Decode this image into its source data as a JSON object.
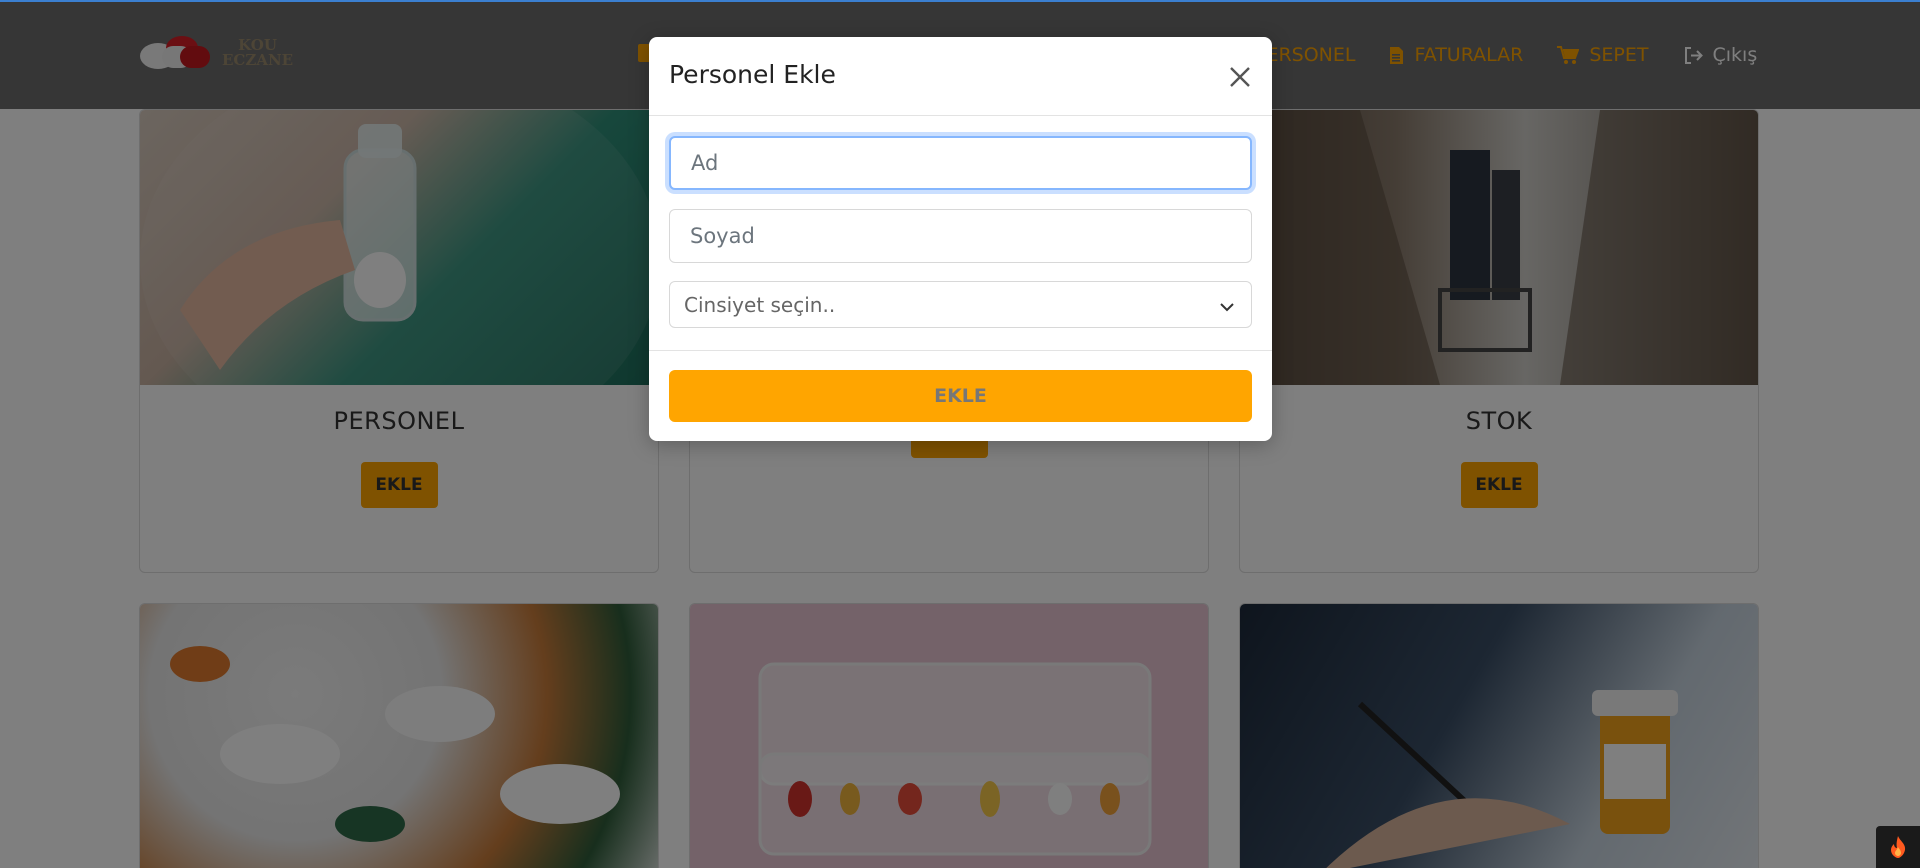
{
  "app": {
    "logo_lines": [
      "KOU",
      "ECZANE"
    ]
  },
  "nav": {
    "items": [
      {
        "label": "PERSONEL",
        "icon": "users-icon"
      },
      {
        "label": "FATURALAR",
        "icon": "file-icon"
      },
      {
        "label": "SEPET",
        "icon": "cart-icon"
      },
      {
        "label": "Çıkış",
        "icon": "sign-out-icon"
      }
    ]
  },
  "cards": [
    {
      "title": "PERSONEL",
      "button": "EKLE"
    },
    {
      "title": "",
      "button": "EKLE"
    },
    {
      "title": "STOK",
      "button": "EKLE"
    }
  ],
  "modal": {
    "title": "Personel Ekle",
    "fields": {
      "ad_placeholder": "Ad",
      "soyad_placeholder": "Soyad",
      "gender_select": "Cinsiyet seçin.."
    },
    "submit_label": "EKLE"
  },
  "colors": {
    "accent": "#ffa500",
    "navbar": "#6c6c6c",
    "backdrop": "rgba(0,0,0,0.5)",
    "focus_ring": "#86b7fe"
  }
}
